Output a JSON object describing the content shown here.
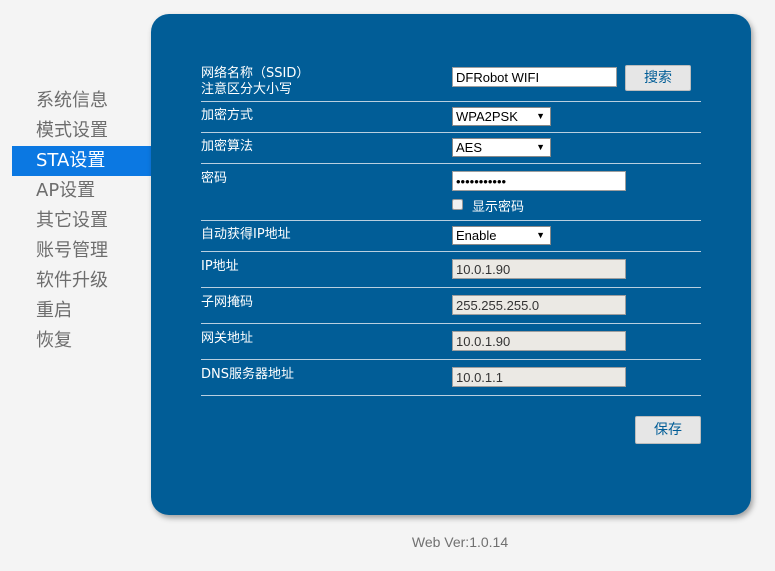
{
  "sidebar": {
    "items": [
      {
        "label": "系统信息"
      },
      {
        "label": "模式设置"
      },
      {
        "label": "STA设置"
      },
      {
        "label": "AP设置"
      },
      {
        "label": "其它设置"
      },
      {
        "label": "账号管理"
      },
      {
        "label": "软件升级"
      },
      {
        "label": "重启"
      },
      {
        "label": "恢复"
      }
    ],
    "active": "STA设置"
  },
  "form": {
    "ssid": {
      "label_line1": "网络名称（SSID）",
      "label_line2": "注意区分大小写",
      "value": "DFRobot WIFI",
      "search_button": "搜索"
    },
    "encryption_mode": {
      "label": "加密方式",
      "selected": "WPA2PSK"
    },
    "encryption_algorithm": {
      "label": "加密算法",
      "selected": "AES"
    },
    "password": {
      "label": "密码",
      "value": "•••••••••••",
      "show_password_label": "显示密码",
      "show_password_checked": false
    },
    "dhcp": {
      "label": "自动获得IP地址",
      "selected": "Enable"
    },
    "ip_address": {
      "label": "IP地址",
      "value": "10.0.1.90"
    },
    "subnet_mask": {
      "label": "子网掩码",
      "value": "255.255.255.0"
    },
    "gateway": {
      "label": "网关地址",
      "value": "10.0.1.90"
    },
    "dns": {
      "label": "DNS服务器地址",
      "value": "10.0.1.1"
    },
    "save_button": "保存"
  },
  "footer": {
    "version": "Web Ver:1.0.14"
  },
  "colors": {
    "panel": "#015d97",
    "active_nav": "#0b78e2",
    "page_background": "#f4f4f4"
  },
  "icons": {
    "select_arrow": "dropdown-arrow-icon"
  }
}
